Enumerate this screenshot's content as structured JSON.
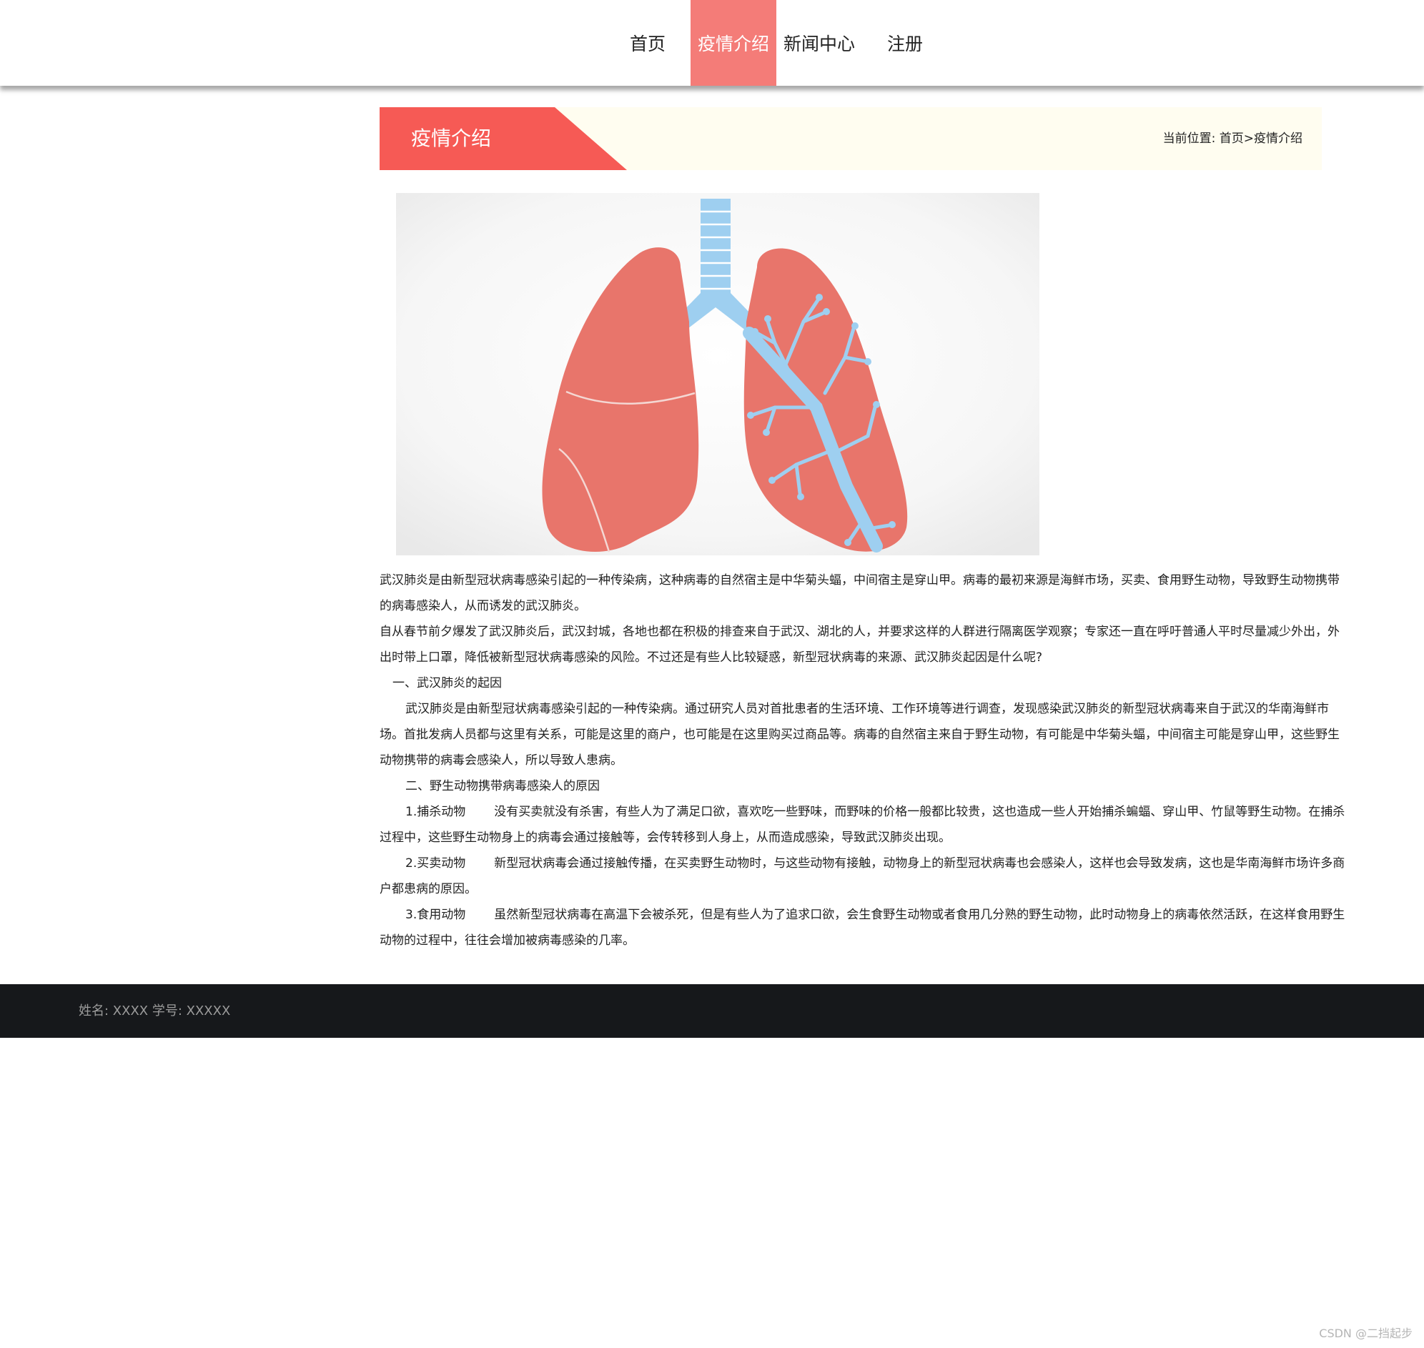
{
  "nav": {
    "items": [
      {
        "label": "首页",
        "active": false
      },
      {
        "label": "疫情介绍",
        "active": true
      },
      {
        "label": "新闻中心",
        "active": false
      },
      {
        "label": "注册",
        "active": false
      }
    ]
  },
  "banner": {
    "title": "疫情介绍",
    "breadcrumb_prefix": "当前位置:",
    "breadcrumb_home": "首页",
    "breadcrumb_sep": ">",
    "breadcrumb_current": "疫情介绍"
  },
  "article": {
    "p1": "武汉肺炎是由新型冠状病毒感染引起的一种传染病，这种病毒的自然宿主是中华菊头蝠，中间宿主是穿山甲。病毒的最初来源是海鲜市场，买卖、食用野生动物，导致野生动物携带的病毒感染人，从而诱发的武汉肺炎。",
    "p2": "自从春节前夕爆发了武汉肺炎后，武汉封城，各地也都在积极的排查来自于武汉、湖北的人，并要求这样的人群进行隔离医学观察；专家还一直在呼吁普通人平时尽量减少外出，外出时带上口罩，降低被新型冠状病毒感染的风险。不过还是有些人比较疑惑，新型冠状病毒的来源、武汉肺炎起因是什么呢?",
    "h1": "一、武汉肺炎的起因",
    "p3": "武汉肺炎是由新型冠状病毒感染引起的一种传染病。通过研究人员对首批患者的生活环境、工作环境等进行调查，发现感染武汉肺炎的新型冠状病毒来自于武汉的华南海鲜市场。首批发病人员都与这里有关系，可能是这里的商户，也可能是在这里购买过商品等。病毒的自然宿主来自于野生动物，有可能是中华菊头蝠，中间宿主可能是穿山甲，这些野生动物携带的病毒会感染人，所以导致人患病。",
    "h2": "二、野生动物携带病毒感染人的原因",
    "i1_title": "1.捕杀动物",
    "i1_text": "没有买卖就没有杀害，有些人为了满足口欲，喜欢吃一些野味，而野味的价格一般都比较贵，这也造成一些人开始捕杀蝙蝠、穿山甲、竹鼠等野生动物。在捕杀过程中，这些野生动物身上的病毒会通过接触等，会传转移到人身上，从而造成感染，导致武汉肺炎出现。",
    "i2_title": "2.买卖动物",
    "i2_text": "新型冠状病毒会通过接触传播，在买卖野生动物时，与这些动物有接触，动物身上的新型冠状病毒也会感染人，这样也会导致发病，这也是华南海鲜市场许多商户都患病的原因。",
    "i3_title": "3.食用动物",
    "i3_text": "虽然新型冠状病毒在高温下会被杀死，但是有些人为了追求口欲，会生食野生动物或者食用几分熟的野生动物，此时动物身上的病毒依然活跃，在这样食用野生动物的过程中，往往会增加被病毒感染的几率。"
  },
  "footer": {
    "text": "姓名: XXXX 学号:   XXXXX"
  },
  "watermark": "CSDN @二挡起步",
  "colors": {
    "accent": "#f47c78",
    "banner_red": "#f65a55",
    "banner_bg": "#fffdf0",
    "footer_bg": "#16181b",
    "lung": "#e8756b",
    "airway": "#9ecff0"
  },
  "icons": {
    "illustration": "lungs-illustration"
  }
}
